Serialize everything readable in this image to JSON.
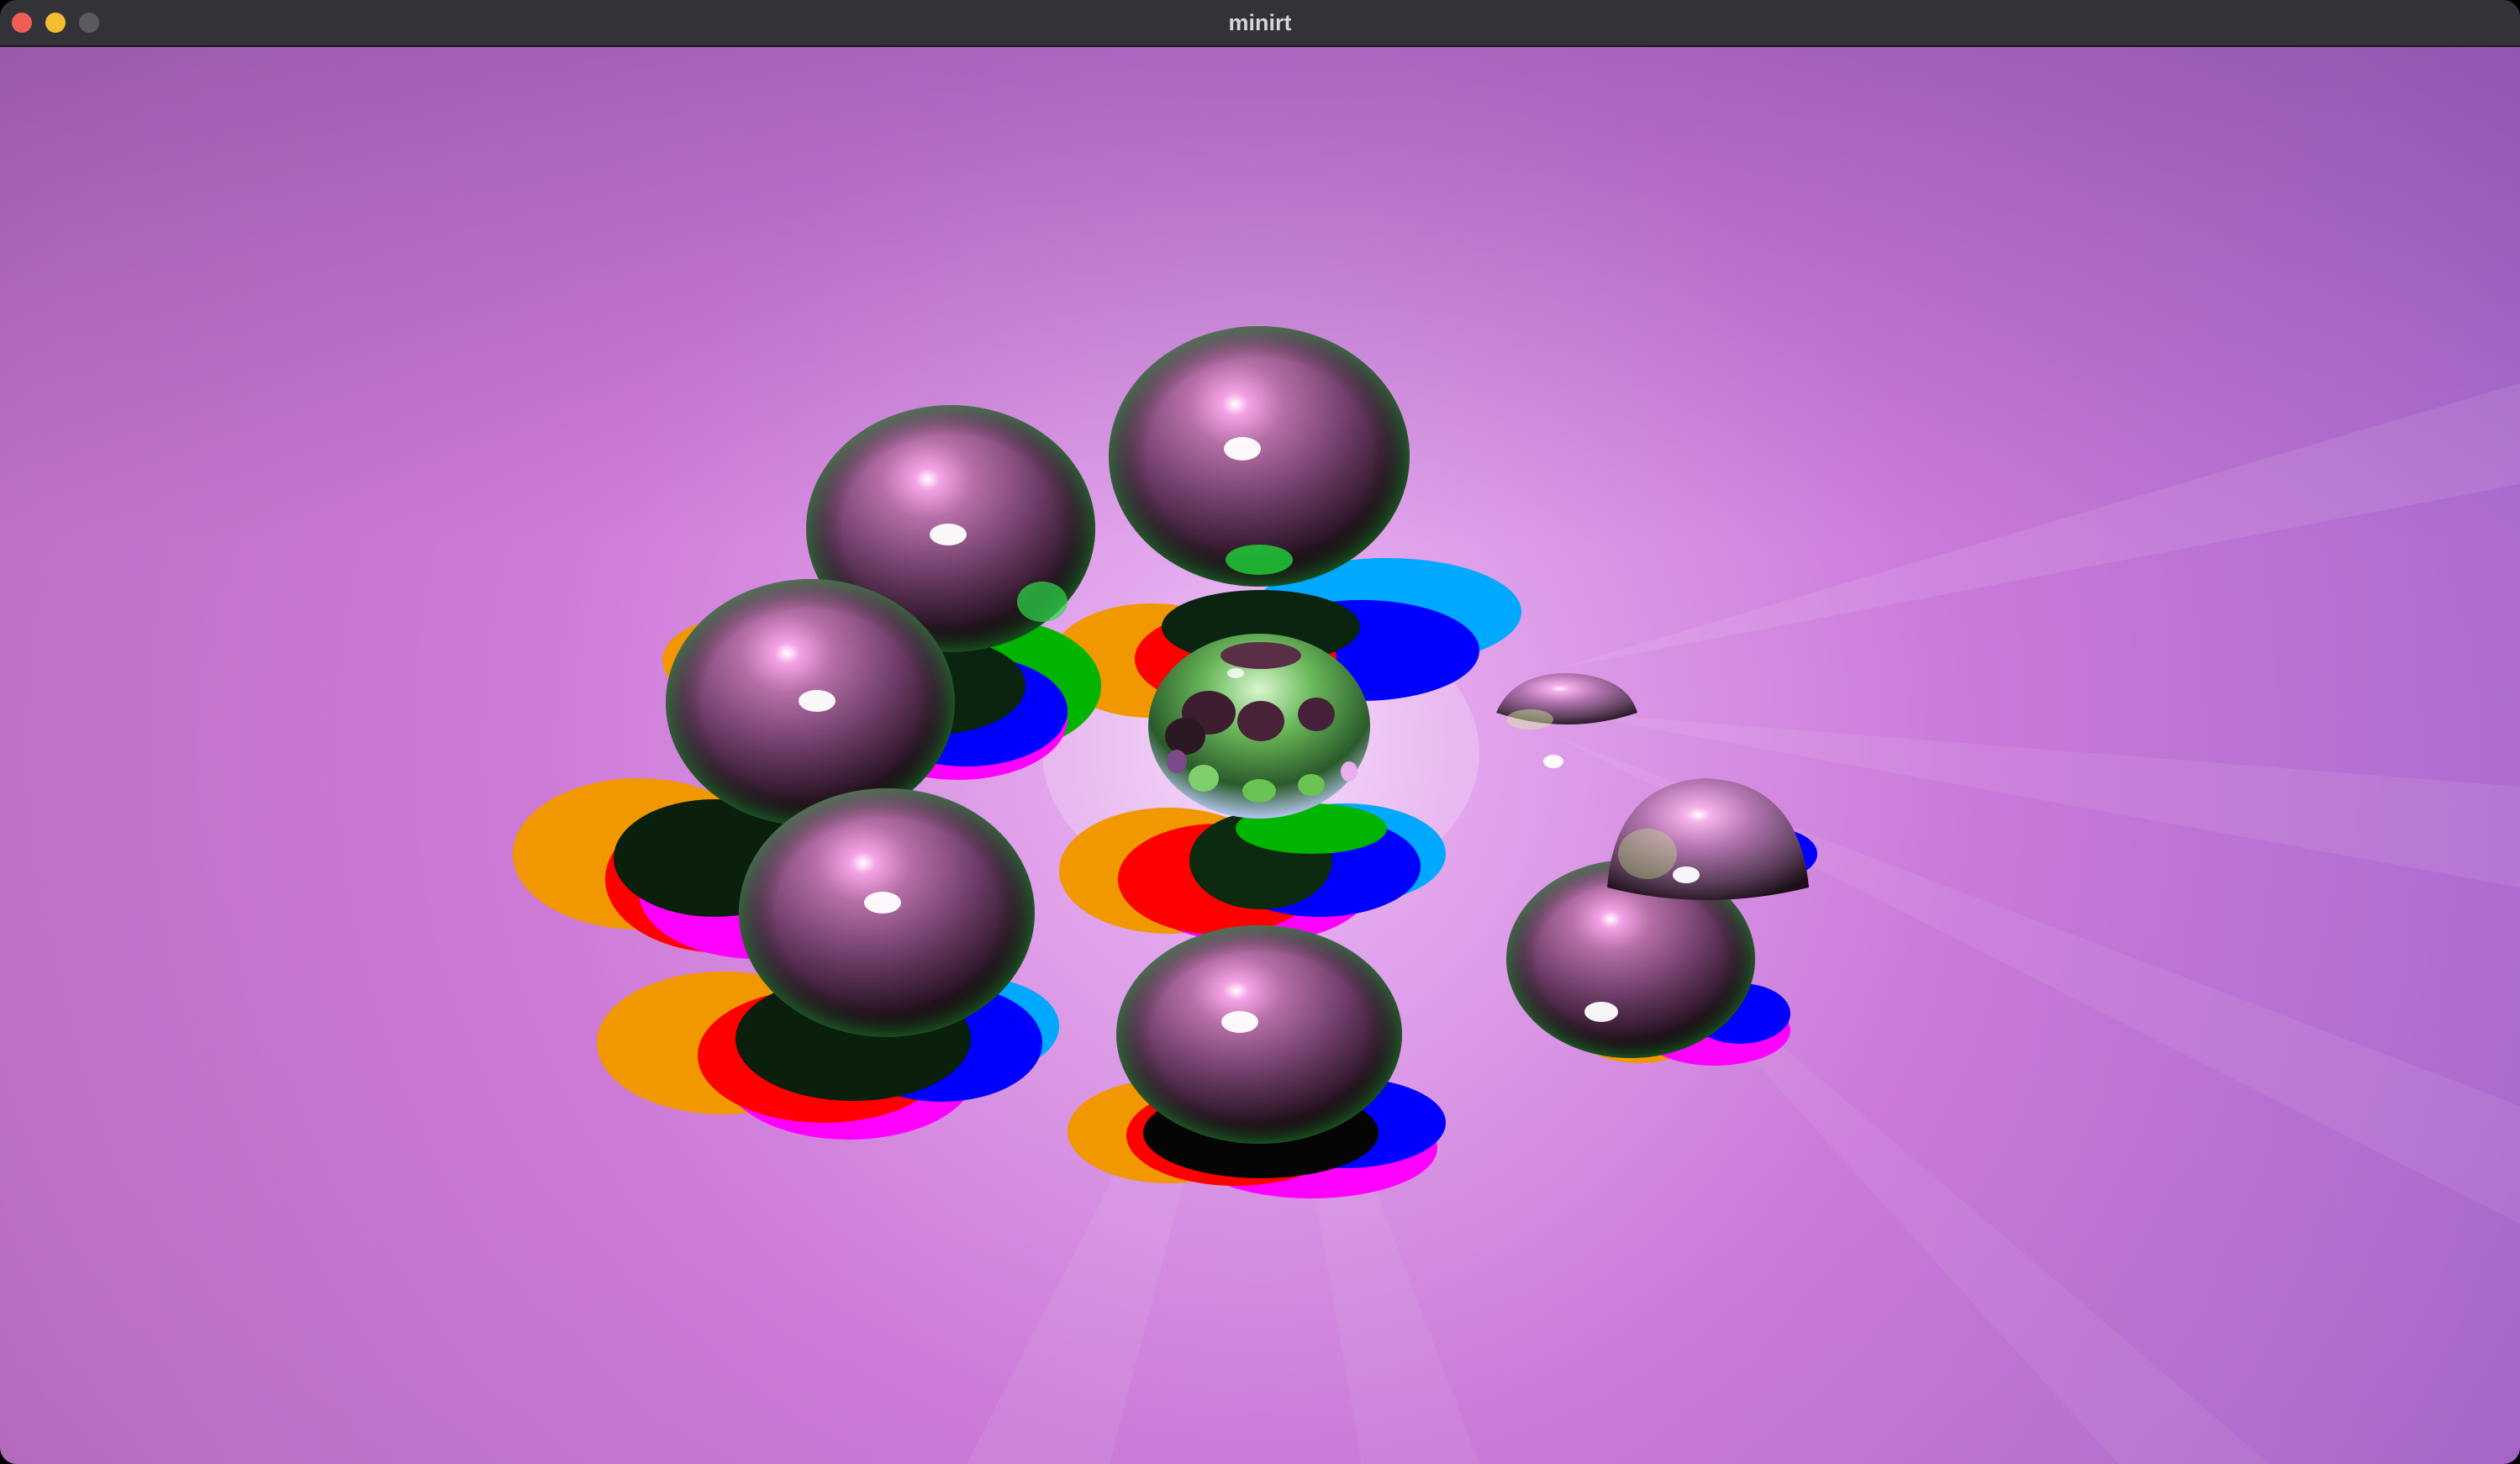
{
  "window": {
    "title": "minirt",
    "controls": {
      "close_color": "#ee5e57",
      "minimize_color": "#f6bc31",
      "zoom_color": "#5b5a60"
    }
  },
  "scene": {
    "description_colors": {
      "background_top": "#915aa6",
      "background_center": "#ecc2f6",
      "background_bottom": "#d277d6",
      "sphere_base": "#9a5a86",
      "shadow_orange": "#f19700",
      "shadow_red": "#ff0000",
      "shadow_blue": "#0000ff",
      "shadow_cyan": "#00b4ff",
      "shadow_green": "#00b400",
      "shadow_magenta": "#ff00ff"
    }
  }
}
